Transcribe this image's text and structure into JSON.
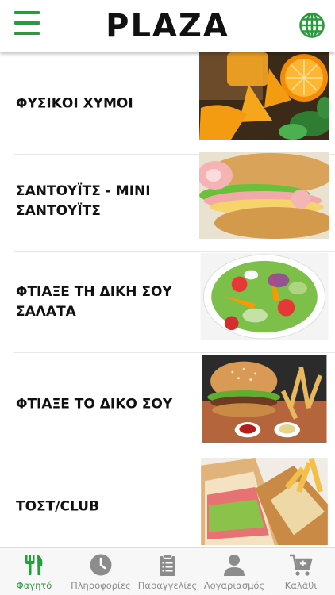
{
  "header": {
    "logo": "PLAZA",
    "menu_icon": "hamburger-menu-icon",
    "language_icon": "globe-icon"
  },
  "categories": [
    {
      "label": "ΦΥΣΙΚΟΙ ΧΥΜΟΙ",
      "image": "orange-juice-photo"
    },
    {
      "label": "ΣΑΝΤΟΥΪΤΣ - ΜΙΝΙ\nΣΑΝΤΟΥΪΤΣ",
      "image": "sandwich-photo"
    },
    {
      "label": "ΦΤΙΑΞΕ ΤΗ ΔΙΚΗ ΣΟΥ\nΣΑΛΑΤΑ",
      "image": "salad-photo"
    },
    {
      "label": "ΦΤΙΑΞΕ ΤΟ ΔΙΚΟ ΣΟΥ",
      "image": "burger-photo"
    },
    {
      "label": "ΤΟΣΤ/CLUB",
      "image": "club-sandwich-photo"
    }
  ],
  "tabbar": {
    "tabs": [
      {
        "label": "Φαγητό",
        "icon": "fork-knife-icon",
        "active": true
      },
      {
        "label": "Πληροφορίες",
        "icon": "clock-icon",
        "active": false
      },
      {
        "label": "Παραγγελίες",
        "icon": "clipboard-icon",
        "active": false
      },
      {
        "label": "Λογαριασμός",
        "icon": "user-icon",
        "active": false
      },
      {
        "label": "Καλάθι",
        "icon": "cart-icon",
        "active": false
      }
    ]
  },
  "colors": {
    "accent": "#2a9a3f",
    "inactive": "#8c8c8c",
    "text": "#111111"
  }
}
